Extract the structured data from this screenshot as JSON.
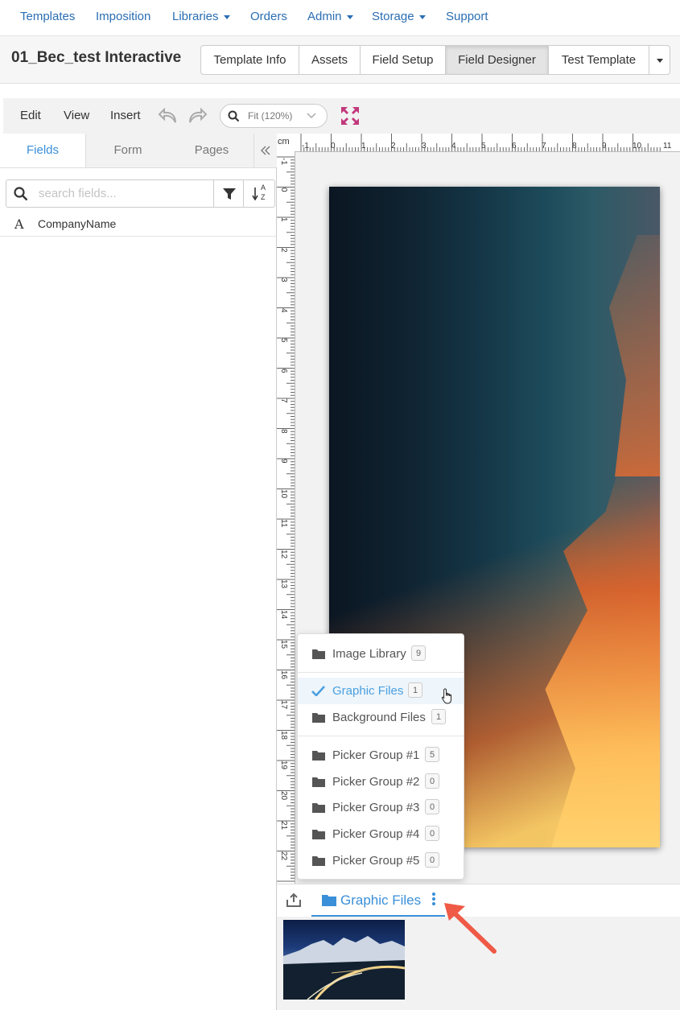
{
  "topnav": {
    "items": [
      {
        "label": "Templates"
      },
      {
        "label": "Imposition"
      },
      {
        "label": "Libraries"
      },
      {
        "label": "Orders"
      },
      {
        "label": "Admin"
      },
      {
        "label": "Storage"
      },
      {
        "label": "Support"
      }
    ]
  },
  "header": {
    "title": "01_Bec_test Interactive",
    "tabs": [
      {
        "label": "Template Info"
      },
      {
        "label": "Assets"
      },
      {
        "label": "Field Setup"
      },
      {
        "label": "Field Designer",
        "active": true
      },
      {
        "label": "Test Template"
      }
    ]
  },
  "toolbar": {
    "menus": [
      "Edit",
      "View",
      "Insert"
    ],
    "zoom": "Fit (120%)"
  },
  "left_panel": {
    "tabs": [
      "Fields",
      "Form",
      "Pages"
    ],
    "active_tab": "Fields",
    "search_placeholder": "search fields...",
    "sort_glyph_top": "A",
    "sort_glyph_bottom": "Z",
    "fields": [
      {
        "type_glyph": "A",
        "name": "CompanyName"
      }
    ]
  },
  "ruler": {
    "unit": "cm",
    "top_labels": [
      "-1",
      "0",
      "1",
      "2",
      "3",
      "4",
      "5",
      "6",
      "7",
      "8",
      "9",
      "10",
      "11"
    ],
    "left_labels": [
      "-1",
      "0",
      "1",
      "2",
      "3",
      "4",
      "5",
      "6",
      "7",
      "8",
      "9",
      "10",
      "11",
      "12",
      "13",
      "14",
      "15",
      "16",
      "17",
      "18",
      "19",
      "20",
      "21",
      "22"
    ]
  },
  "folder_menu": {
    "items": [
      {
        "label": "Image Library",
        "count": "9"
      },
      {
        "label": "Graphic Files",
        "count": "1",
        "selected": true
      },
      {
        "label": "Background Files",
        "count": "1"
      },
      {
        "label": "Picker Group #1",
        "count": "5"
      },
      {
        "label": "Picker Group #2",
        "count": "0"
      },
      {
        "label": "Picker Group #3",
        "count": "0"
      },
      {
        "label": "Picker Group #4",
        "count": "0"
      },
      {
        "label": "Picker Group #5",
        "count": "0"
      }
    ]
  },
  "asset_bar": {
    "active_folder": "Graphic Files"
  },
  "colors": {
    "link": "#2a6eb3",
    "accent": "#3a8fd9",
    "arrow": "#ef5a46"
  }
}
